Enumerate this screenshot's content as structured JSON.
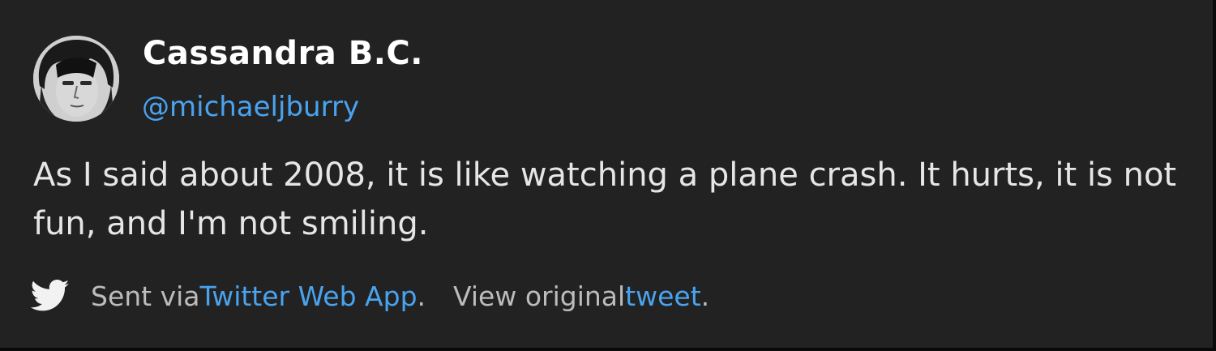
{
  "user": {
    "display_name": "Cassandra B.C.",
    "handle": "@michaeljburry",
    "avatar_icon": "user-avatar"
  },
  "tweet": {
    "text": "As I said about 2008, it is like watching a plane crash. It hurts, it is not fun, and I'm not smiling."
  },
  "footer": {
    "icon": "twitter-bird-icon",
    "sent_via_prefix": "Sent via ",
    "source_link": "Twitter Web App",
    "period_1": ".",
    "view_prefix": "View original ",
    "view_link": "tweet",
    "period_2": "."
  },
  "colors": {
    "background": "#222222",
    "link": "#4aa3ef",
    "name": "#ffffff",
    "text": "#e6e6e6",
    "muted": "#bcbcbc"
  }
}
